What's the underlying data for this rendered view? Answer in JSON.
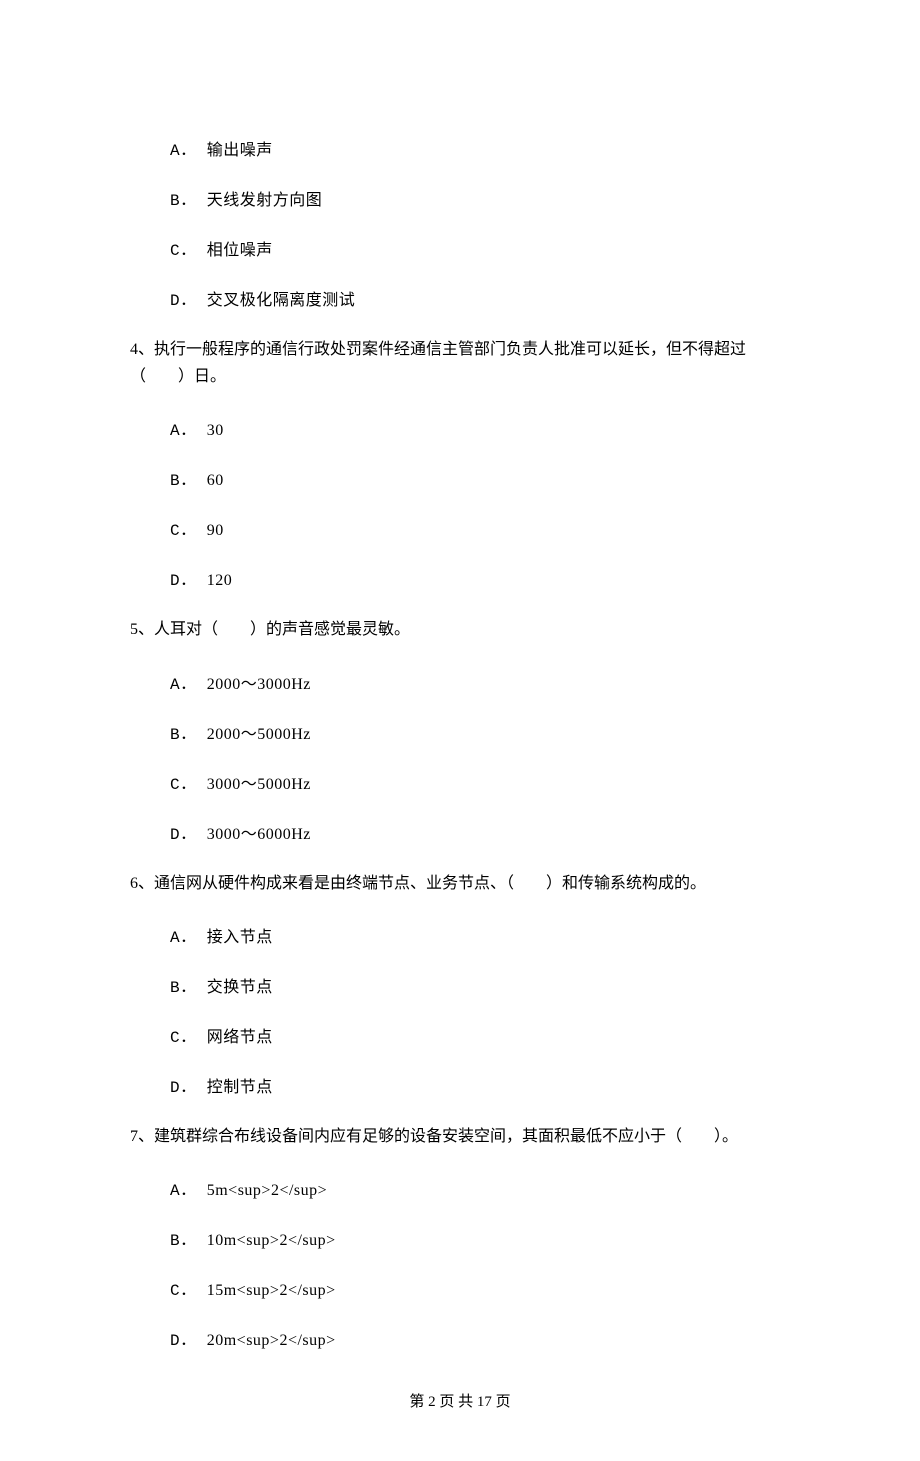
{
  "q3": {
    "options": {
      "A": "输出噪声",
      "B": "天线发射方向图",
      "C": "相位噪声",
      "D": "交叉极化隔离度测试"
    }
  },
  "q4": {
    "stem": "4、执行一般程序的通信行政处罚案件经通信主管部门负责人批准可以延长，但不得超过（　　）日。",
    "options": {
      "A": "30",
      "B": "60",
      "C": "90",
      "D": "120"
    }
  },
  "q5": {
    "stem": "5、人耳对（　　）的声音感觉最灵敏。",
    "options": {
      "A": "2000～3000Hz",
      "B": "2000～5000Hz",
      "C": "3000～5000Hz",
      "D": "3000～6000Hz"
    }
  },
  "q6": {
    "stem": "6、通信网从硬件构成来看是由终端节点、业务节点、（　　）和传输系统构成的。",
    "options": {
      "A": "接入节点",
      "B": "交换节点",
      "C": "网络节点",
      "D": "控制节点"
    }
  },
  "q7": {
    "stem": "7、建筑群综合布线设备间内应有足够的设备安装空间，其面积最低不应小于（　　）。",
    "options": {
      "A": "5m<sup>2</sup>",
      "B": "10m<sup>2</sup>",
      "C": "15m<sup>2</sup>",
      "D": "20m<sup>2</sup>"
    }
  },
  "labels": {
    "A": "A．",
    "B": "B．",
    "C": "C．",
    "D": "D．"
  },
  "footer": "第 2 页 共 17 页"
}
